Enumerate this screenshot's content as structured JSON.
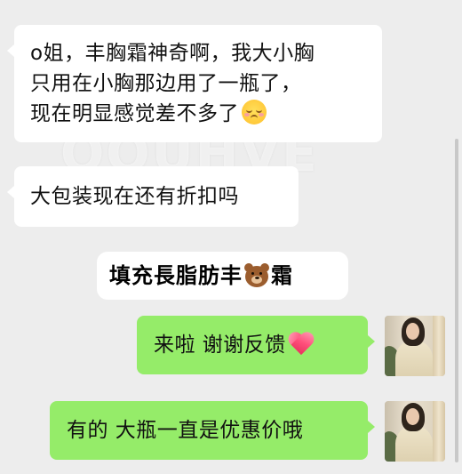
{
  "chat": {
    "messages": [
      {
        "sender": "other",
        "lines": [
          "o姐，丰胸霜神奇啊，我大小胸",
          "只用在小胸那边用了一瓶了，",
          "现在明显感觉差不多了"
        ],
        "emoji": "smiling-face-with-squinting-eyes-icon"
      },
      {
        "sender": "other",
        "text": "大包装现在还有折扣吗"
      },
      {
        "sender": "self",
        "text": "来啦 谢谢反馈",
        "emoji": "heart-icon"
      },
      {
        "sender": "self",
        "text": "有的 大瓶一直是优惠价哦"
      }
    ],
    "sticker_label": {
      "before": "填充長脂肪丰",
      "emoji": "bear-face-icon",
      "after": "霜"
    },
    "watermark": "OOUHVE"
  },
  "colors": {
    "background": "#ededed",
    "incoming_bubble": "#ffffff",
    "outgoing_bubble": "#95ec69"
  }
}
